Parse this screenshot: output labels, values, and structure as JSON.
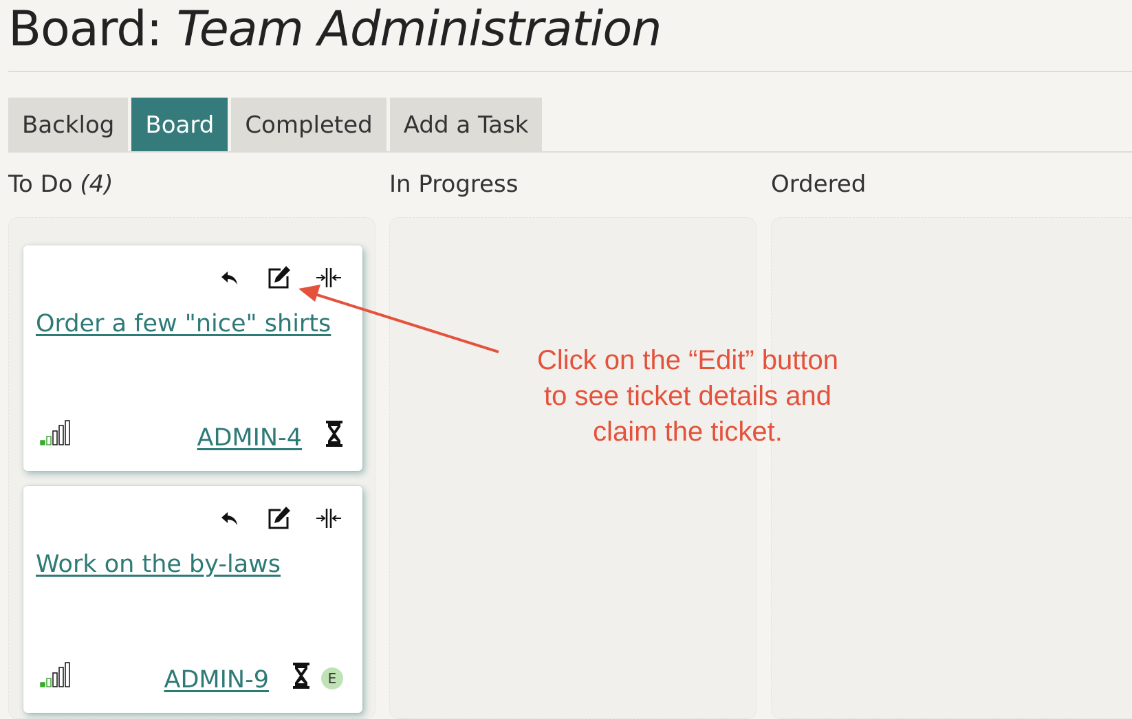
{
  "header": {
    "prefix": "Board:",
    "board_name": "Team Administration"
  },
  "tabs": [
    {
      "label": "Backlog",
      "active": false
    },
    {
      "label": "Board",
      "active": true
    },
    {
      "label": "Completed",
      "active": false
    },
    {
      "label": "Add a Task",
      "active": false
    }
  ],
  "columns": [
    {
      "title": "To Do",
      "count": "(4)"
    },
    {
      "title": "In Progress"
    },
    {
      "title": "Ordered"
    }
  ],
  "cards": [
    {
      "title": "Order a few \"nice\" shirts",
      "ticket_id": "ADMIN-4",
      "assignee": ""
    },
    {
      "title": "Work on the by-laws",
      "ticket_id": "ADMIN-9",
      "assignee": "E"
    }
  ],
  "annotation": {
    "line1": "Click on the “Edit” button",
    "line2": "to see ticket details and",
    "line3": "claim the ticket."
  },
  "colors": {
    "accent": "#367b7b",
    "link": "#2e7a76",
    "annotation": "#e4523b",
    "signal_active": "#3aa72f",
    "avatar_bg": "#bfe3b4"
  },
  "icons": [
    "reply-icon",
    "edit-icon",
    "collapse-icon",
    "signal-icon",
    "hourglass-icon"
  ]
}
